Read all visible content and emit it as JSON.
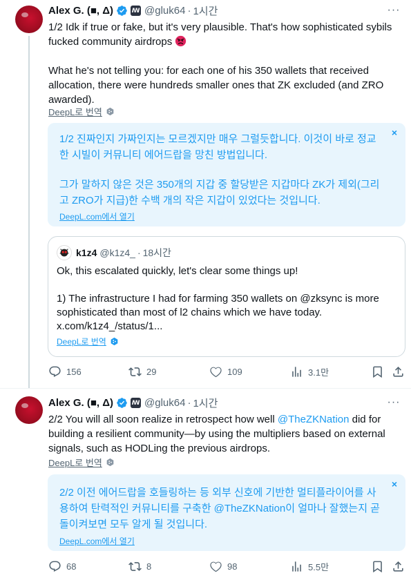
{
  "tweets": [
    {
      "author": "Alex G. (■, Δ)",
      "handle": "@gluk64",
      "time": "1시간",
      "body_p1_a": "1/2 Idk if true or fake, but it's very plausible. That's how sophisticated sybils fucked community airdrops ",
      "body_p2": "What he's not telling you: for each one of his 350 wallets that received allocation, there were hundreds smaller ones that ZK excluded (and ZRO awarded).",
      "deepl_label": "DeepL로 번역",
      "translation_p1": "1/2 진짜인지 가짜인지는 모르겠지만 매우 그럴듯합니다. 이것이 바로 정교한 시빌이 커뮤니티 에어드랍을 망친 방법입니다.",
      "translation_p2": "그가 말하지 않은 것은 350개의 지갑 중 할당받은 지갑마다 ZK가 제외(그리고 ZRO가 지급)한 수백 개의 작은 지갑이 있었다는 것입니다.",
      "translation_link": "DeepL.com에서 열기",
      "stats": {
        "replies": "156",
        "retweets": "29",
        "likes": "109",
        "views": "3.1만"
      }
    },
    {
      "author": "Alex G. (■, Δ)",
      "handle": "@gluk64",
      "time": "1시간",
      "body_a": "2/2 You will all soon realize in retrospect how well ",
      "mention": "@TheZKNation",
      "body_b": " did for building a resilient community—by using the multipliers based on external signals, such as HODLing the previous airdrops.",
      "deepl_label": "DeepL로 번역",
      "translation": "2/2 이전 에어드랍을 호들링하는 등 외부 신호에 기반한 멀티플라이어를 사용하여 탄력적인 커뮤니티를 구축한 @TheZKNation이 얼마나 잘했는지 곧 돌이켜보면 모두 알게 될 것입니다.",
      "translation_link": "DeepL.com에서 열기",
      "stats": {
        "replies": "68",
        "retweets": "8",
        "likes": "98",
        "views": "5.5만"
      }
    }
  ],
  "quote": {
    "author": "k1z4",
    "handle": "@k1z4_",
    "time": "18시간",
    "line1": "Ok, this escalated quickly, let's clear some things up!",
    "line2": "1) The infrastructure I had for farming 350 wallets on @zksync is more sophisticated than most of l2 chains which we have today.",
    "line3": "x.com/k1z4_/status/1...",
    "deepl_label": "DeepL로 번역"
  },
  "separator_dot": "·",
  "close_glyph": "×",
  "more_glyph": "···",
  "affiliate_badge": "ꟿ",
  "colors": {
    "accent": "#1d9bf0",
    "translation_bg": "#e8f5fd",
    "muted": "#536471",
    "avatar_red": "#c8102e"
  },
  "icons": [
    "verified-badge-icon",
    "more-icon",
    "reply-icon",
    "retweet-icon",
    "like-icon",
    "views-icon",
    "bookmark-icon",
    "share-icon",
    "deepl-logo-icon",
    "angry-face-emoji-icon",
    "close-icon"
  ]
}
